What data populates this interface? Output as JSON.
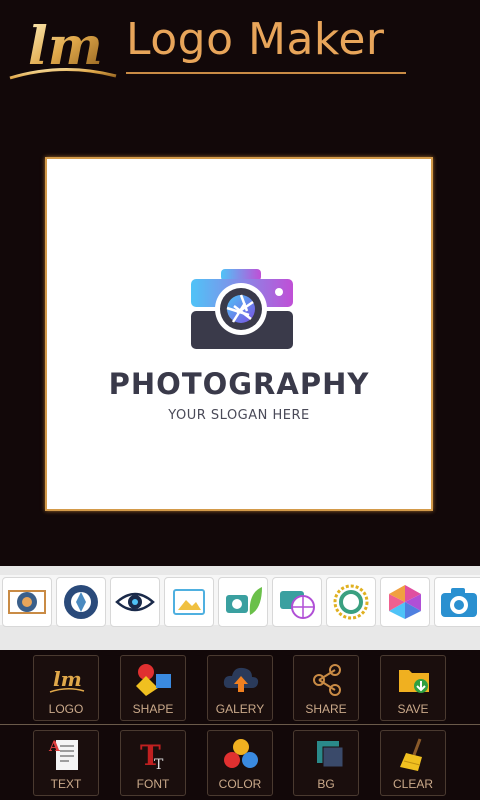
{
  "header": {
    "logo_text": "lm",
    "title": "Logo Maker"
  },
  "canvas": {
    "brand_name": "PHOTOGRAPHY",
    "slogan": "YOUR SLOGAN HERE",
    "colors": {
      "gradient_start": "#4fc3f7",
      "gradient_end": "#b04fd6",
      "dark": "#3a3a4a"
    }
  },
  "templates": [
    {
      "icon": "film-lens-icon"
    },
    {
      "icon": "shutter-icon"
    },
    {
      "icon": "eye-icon"
    },
    {
      "icon": "photo-frame-icon"
    },
    {
      "icon": "leaf-camera-icon"
    },
    {
      "icon": "globe-camera-icon"
    },
    {
      "icon": "sun-ring-icon"
    },
    {
      "icon": "colorful-aperture-icon"
    },
    {
      "icon": "blue-camera-icon"
    }
  ],
  "toolbar": {
    "row1": [
      {
        "label": "LOGO",
        "icon": "lm-logo-icon"
      },
      {
        "label": "SHAPE",
        "icon": "shapes-icon"
      },
      {
        "label": "GALERY",
        "icon": "cloud-upload-icon"
      },
      {
        "label": "SHARE",
        "icon": "share-icon"
      },
      {
        "label": "SAVE",
        "icon": "folder-save-icon"
      }
    ],
    "row2": [
      {
        "label": "TEXT",
        "icon": "text-document-icon"
      },
      {
        "label": "FONT",
        "icon": "font-icon"
      },
      {
        "label": "COLOR",
        "icon": "color-balls-icon"
      },
      {
        "label": "BG",
        "icon": "layers-icon"
      },
      {
        "label": "CLEAR",
        "icon": "broom-icon"
      }
    ]
  },
  "accent_color": "#e8a55a"
}
